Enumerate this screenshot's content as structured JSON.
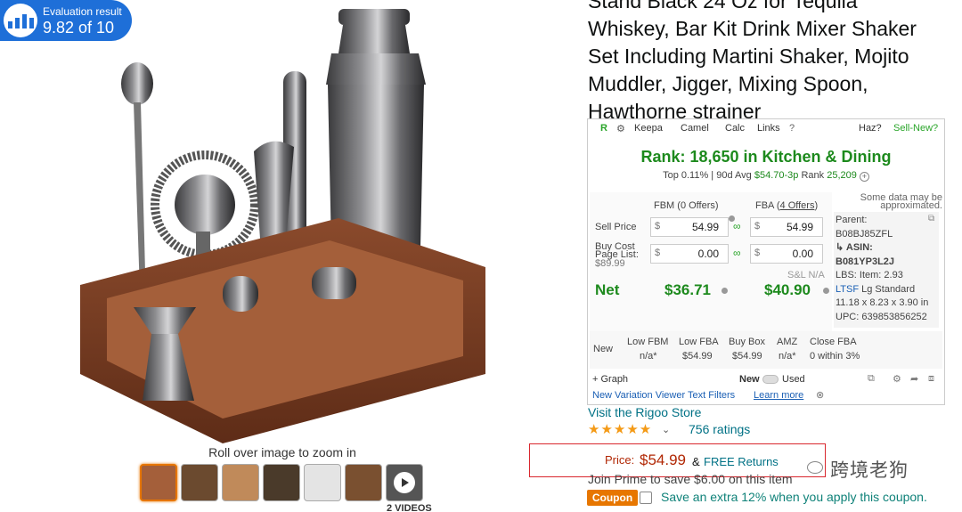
{
  "evaluation": {
    "label": "Evaluation result",
    "score": "9.82 of 10"
  },
  "product": {
    "title_lines": [
      "Stand Black 24 Oz for Tequila",
      "Whiskey, Bar Kit Drink Mixer Shaker",
      "Set Including Martini Shaker, Mojito",
      "Muddler, Jigger, Mixing Spoon,",
      "Hawthorne strainer"
    ],
    "zoom_hint": "Roll over image to zoom in",
    "videos_label": "2 VIDEOS"
  },
  "keepa": {
    "toolbar": {
      "keepa": "Keepa",
      "camel": "Camel",
      "calc": "Calc",
      "links": "Links",
      "haz": "Haz?",
      "sell_new": "Sell-New?"
    },
    "rank": "Rank:  18,650 in Kitchen & Dining",
    "rank_sub": {
      "top": "Top 0.11% | 90d Avg",
      "avg": "$54.70-3p",
      "rank_label": "Rank",
      "rank_val": "25,209"
    },
    "fbm_header": "FBM (0 Offers)",
    "fba_header_prefix": "FBA (",
    "fba_header_link": "4 Offers",
    "fba_header_suffix": ")",
    "approx_note": "Some data may be approximated.",
    "sell_price_label": "Sell Price",
    "buy_cost_label": "Buy Cost",
    "page_list_label": "Page List:",
    "page_list_val": "$89.99",
    "currency": "$",
    "fbm_sell": "54.99",
    "fba_sell": "54.99",
    "fbm_cost": "0.00",
    "fba_cost": "0.00",
    "sl_na": "S&L N/A",
    "net_label": "Net",
    "net_fbm": "$36.71",
    "net_fba": "$40.90",
    "side": {
      "parent_label": "Parent:",
      "parent": "B08BJ85ZFL",
      "asin_label": "ASIN:",
      "asin": "B081YP3L2J",
      "lbs": "LBS: Item: 2.93",
      "ltsf": "LTSF",
      "ltsf_val": "Lg Standard",
      "dims1": "11.18 x 8.23 x 3.90 in",
      "upc": "UPC: 639853856252"
    },
    "stats": {
      "new_label": "New",
      "cols": [
        "Low FBM",
        "Low FBA",
        "Buy Box",
        "AMZ",
        "Close FBA"
      ],
      "vals": [
        "n/a*",
        "$54.99",
        "$54.99",
        "n/a*",
        "0 within 3%"
      ]
    },
    "footer": {
      "graph": "+ Graph",
      "new_label": "New",
      "used_label": "Used",
      "variation_viewer": "New Variation Viewer Text Filters",
      "learn_more": "Learn more"
    }
  },
  "store_link": "Visit the Rigoo Store",
  "rating": {
    "stars": "★★★★★",
    "count": "756 ratings"
  },
  "price": {
    "label": "Price:",
    "value": "$54.99",
    "amp": "&",
    "returns": "FREE Returns"
  },
  "prime": "Join Prime to save $6.00 on this item",
  "coupon": {
    "tag": "Coupon",
    "text": "Save an extra 12% when you apply this coupon."
  },
  "watermark": "跨境老狗",
  "colors": {
    "accent": "#1e6fd8",
    "price": "#b12704",
    "keepa_green": "#1d8a1d",
    "link": "#007185",
    "highlight_box": "#d9272e",
    "coupon": "#e77600"
  }
}
